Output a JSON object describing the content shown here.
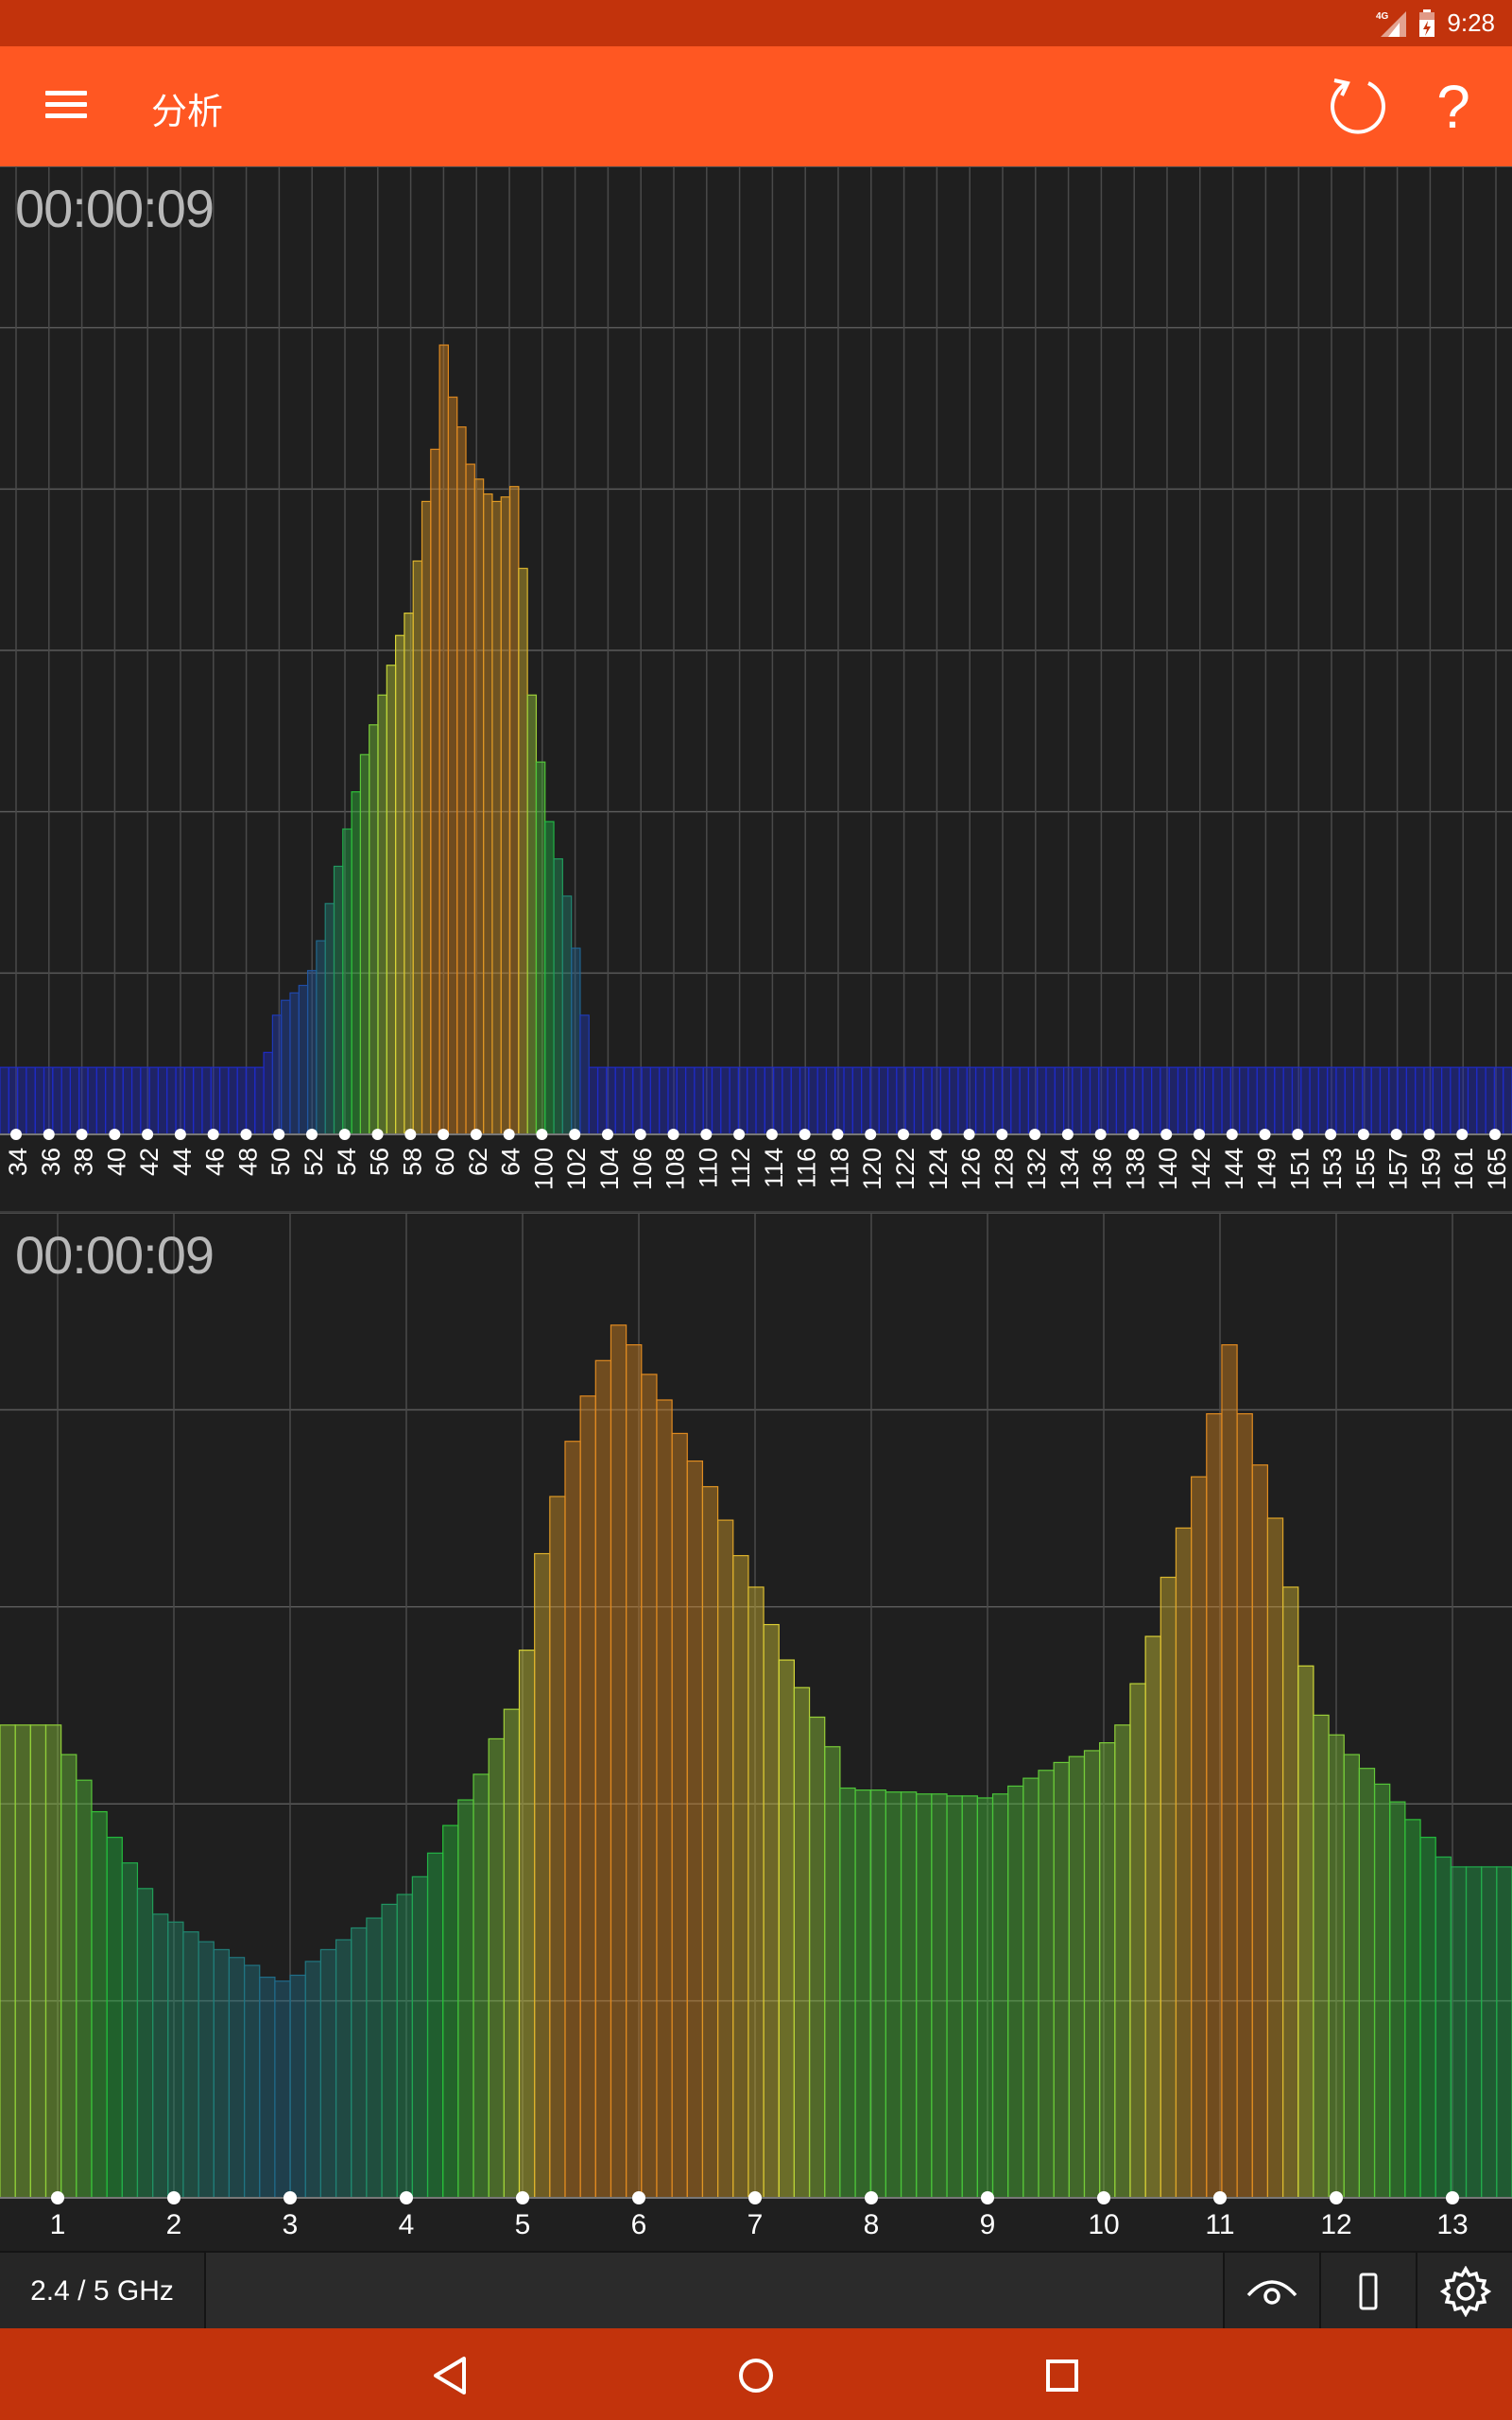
{
  "status_bar": {
    "time": "9:28",
    "network": "4G"
  },
  "app_bar": {
    "title": "分析",
    "help_symbol": "?"
  },
  "panels": {
    "top_timer": "00:00:09",
    "bottom_timer": "00:00:09"
  },
  "toolbar": {
    "band_label": "2.4 / 5 GHz"
  },
  "icons": {
    "menu": "menu-icon",
    "refresh": "refresh-icon",
    "help": "help-icon",
    "eye": "eye-icon",
    "phone": "phone-icon",
    "gear": "gear-icon",
    "back": "back-icon",
    "home": "home-icon",
    "recents": "recents-icon"
  },
  "colors": {
    "status_bar": "#c2330c",
    "app_bar": "#ff5722",
    "background": "#1f1f1f",
    "low": "#1f2bc8",
    "mid": "#22c03a",
    "high": "#d8d838",
    "peak": "#e08a20"
  },
  "chart_data": [
    {
      "type": "bar",
      "panel": "5 GHz",
      "x_tick_labels": [
        "34",
        "36",
        "38",
        "40",
        "42",
        "44",
        "46",
        "48",
        "50",
        "52",
        "54",
        "56",
        "58",
        "60",
        "62",
        "64",
        "100",
        "102",
        "104",
        "106",
        "108",
        "110",
        "112",
        "114",
        "116",
        "118",
        "120",
        "122",
        "124",
        "126",
        "128",
        "132",
        "134",
        "136",
        "138",
        "140",
        "142",
        "144",
        "149",
        "151",
        "153",
        "155",
        "157",
        "159",
        "161",
        "165"
      ],
      "ylim": [
        0,
        6.5
      ],
      "grid": true,
      "values": [
        0.45,
        0.45,
        0.45,
        0.45,
        0.45,
        0.45,
        0.45,
        0.45,
        0.45,
        0.45,
        0.45,
        0.45,
        0.45,
        0.45,
        0.45,
        0.45,
        0.45,
        0.45,
        0.45,
        0.45,
        0.45,
        0.45,
        0.45,
        0.45,
        0.45,
        0.45,
        0.45,
        0.45,
        0.45,
        0.45,
        0.55,
        0.8,
        0.9,
        0.95,
        1.0,
        1.1,
        1.3,
        1.55,
        1.8,
        2.05,
        2.3,
        2.55,
        2.75,
        2.95,
        3.15,
        3.35,
        3.5,
        3.85,
        4.25,
        4.6,
        5.3,
        4.95,
        4.75,
        4.5,
        4.4,
        4.3,
        4.25,
        4.28,
        4.35,
        3.8,
        2.95,
        2.5,
        2.1,
        1.85,
        1.6,
        1.25,
        0.8,
        0.45,
        0.45,
        0.45,
        0.45,
        0.45,
        0.45,
        0.45,
        0.45,
        0.45,
        0.45,
        0.45,
        0.45,
        0.45,
        0.45,
        0.45,
        0.45,
        0.45,
        0.45,
        0.45,
        0.45,
        0.45,
        0.45,
        0.45,
        0.45,
        0.45,
        0.45,
        0.45,
        0.45,
        0.45,
        0.45,
        0.45,
        0.45,
        0.45,
        0.45,
        0.45,
        0.45,
        0.45,
        0.45,
        0.45,
        0.45,
        0.45,
        0.45,
        0.45,
        0.45,
        0.45,
        0.45,
        0.45,
        0.45,
        0.45,
        0.45,
        0.45,
        0.45,
        0.45,
        0.45,
        0.45,
        0.45,
        0.45,
        0.45,
        0.45,
        0.45,
        0.45,
        0.45,
        0.45,
        0.45,
        0.45,
        0.45,
        0.45,
        0.45,
        0.45,
        0.45,
        0.45,
        0.45,
        0.45,
        0.45,
        0.45,
        0.45,
        0.45,
        0.45,
        0.45,
        0.45,
        0.45,
        0.45,
        0.45,
        0.45,
        0.45,
        0.45,
        0.45,
        0.45,
        0.45,
        0.45,
        0.45,
        0.45,
        0.45,
        0.45,
        0.45,
        0.45,
        0.45,
        0.45,
        0.45,
        0.45,
        0.45,
        0.45,
        0.45,
        0.45,
        0.45
      ]
    },
    {
      "type": "bar",
      "panel": "2.4 GHz",
      "x_tick_labels": [
        "1",
        "2",
        "3",
        "4",
        "5",
        "6",
        "7",
        "8",
        "9",
        "10",
        "11",
        "12",
        "13"
      ],
      "ylim": [
        0,
        5
      ],
      "grid": true,
      "values": [
        2.4,
        2.4,
        2.4,
        2.4,
        2.25,
        2.12,
        1.96,
        1.83,
        1.7,
        1.57,
        1.44,
        1.4,
        1.35,
        1.3,
        1.26,
        1.22,
        1.18,
        1.12,
        1.1,
        1.13,
        1.2,
        1.26,
        1.31,
        1.37,
        1.42,
        1.49,
        1.54,
        1.63,
        1.75,
        1.89,
        2.02,
        2.15,
        2.33,
        2.48,
        2.78,
        3.27,
        3.56,
        3.84,
        4.07,
        4.25,
        4.43,
        4.33,
        4.18,
        4.05,
        3.88,
        3.74,
        3.61,
        3.44,
        3.26,
        3.1,
        2.91,
        2.73,
        2.59,
        2.44,
        2.29,
        2.08,
        2.07,
        2.07,
        2.06,
        2.06,
        2.05,
        2.05,
        2.04,
        2.04,
        2.03,
        2.05,
        2.09,
        2.13,
        2.17,
        2.21,
        2.24,
        2.27,
        2.31,
        2.4,
        2.61,
        2.85,
        3.15,
        3.4,
        3.66,
        3.98,
        4.33,
        3.98,
        3.72,
        3.45,
        3.1,
        2.7,
        2.45,
        2.35,
        2.25,
        2.18,
        2.1,
        2.01,
        1.92,
        1.83,
        1.73,
        1.68,
        1.68,
        1.68,
        1.68
      ]
    }
  ]
}
